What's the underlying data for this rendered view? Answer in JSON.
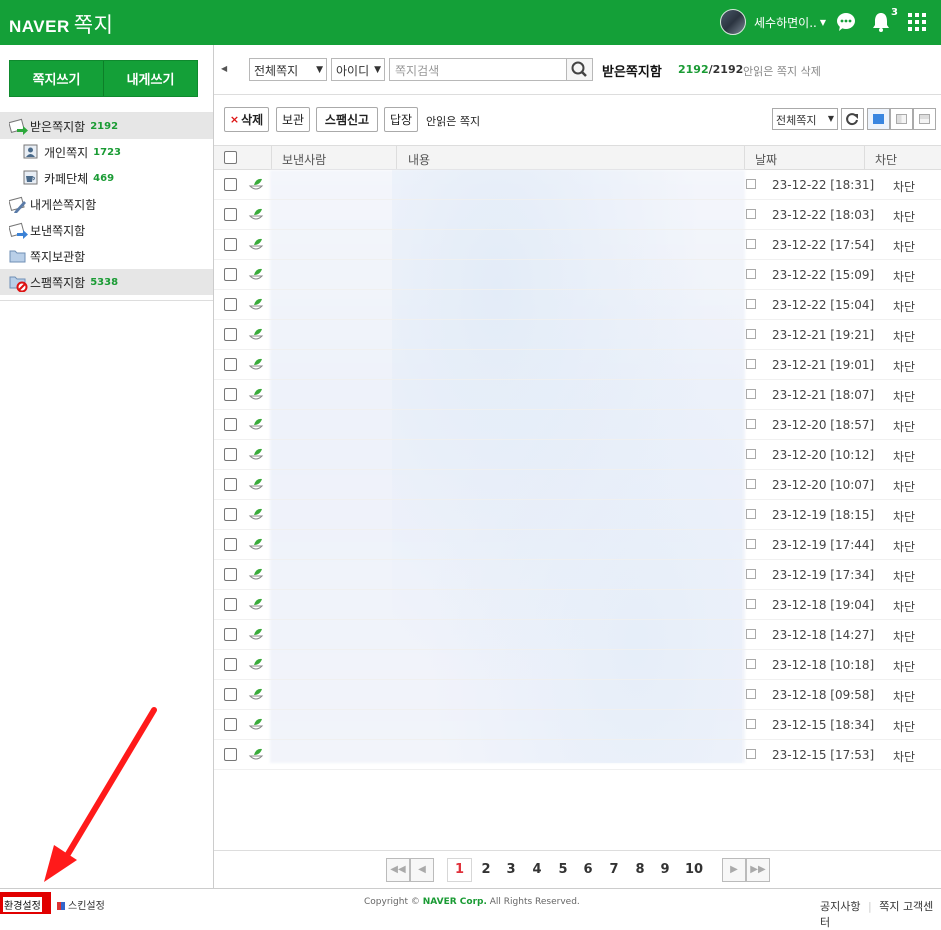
{
  "app": {
    "logo": "NAVER",
    "service": "쪽지"
  },
  "user": {
    "name": "세수하면이..",
    "notif_count": "3"
  },
  "sidebar": {
    "write_btn": "쪽지쓰기",
    "self_btn": "내게쓰기",
    "folders": [
      {
        "label": "받은쪽지함",
        "count": "2192"
      },
      {
        "label": "개인쪽지",
        "count": "1723"
      },
      {
        "label": "카페단체",
        "count": "469"
      },
      {
        "label": "내게쓴쪽지함",
        "count": ""
      },
      {
        "label": "보낸쪽지함",
        "count": ""
      },
      {
        "label": "쪽지보관함",
        "count": ""
      },
      {
        "label": "스팸쪽지함",
        "count": "5338"
      }
    ]
  },
  "search": {
    "filter": "전체쪽지",
    "field": "아이디",
    "placeholder": "쪽지검색"
  },
  "inbox": {
    "title": "받은쪽지함",
    "unread": "2192",
    "sep": "/",
    "total": "2192",
    "delete_unread": "안읽은 쪽지 삭제"
  },
  "toolbar": {
    "delete": "삭제",
    "keep": "보관",
    "spam": "스팸신고",
    "reply": "답장",
    "unread": "안읽은 쪽지",
    "filter": "전체쪽지"
  },
  "table": {
    "headers": {
      "sender": "보낸사람",
      "content": "내용",
      "date": "날짜",
      "block": "차단"
    },
    "rows": [
      {
        "date": "23-12-22 [18:31]",
        "block": "차단"
      },
      {
        "date": "23-12-22 [18:03]",
        "block": "차단"
      },
      {
        "date": "23-12-22 [17:54]",
        "block": "차단"
      },
      {
        "date": "23-12-22 [15:09]",
        "block": "차단"
      },
      {
        "date": "23-12-22 [15:04]",
        "block": "차단"
      },
      {
        "date": "23-12-21 [19:21]",
        "block": "차단"
      },
      {
        "date": "23-12-21 [19:01]",
        "block": "차단"
      },
      {
        "date": "23-12-21 [18:07]",
        "block": "차단"
      },
      {
        "date": "23-12-20 [18:57]",
        "block": "차단"
      },
      {
        "date": "23-12-20 [10:12]",
        "block": "차단"
      },
      {
        "date": "23-12-20 [10:07]",
        "block": "차단"
      },
      {
        "date": "23-12-19 [18:15]",
        "block": "차단"
      },
      {
        "date": "23-12-19 [17:44]",
        "block": "차단"
      },
      {
        "date": "23-12-19 [17:34]",
        "block": "차단"
      },
      {
        "date": "23-12-18 [19:04]",
        "block": "차단"
      },
      {
        "date": "23-12-18 [14:27]",
        "block": "차단"
      },
      {
        "date": "23-12-18 [10:18]",
        "block": "차단"
      },
      {
        "date": "23-12-18 [09:58]",
        "block": "차단"
      },
      {
        "date": "23-12-15 [18:34]",
        "block": "차단"
      },
      {
        "date": "23-12-15 [17:53]",
        "block": "차단"
      }
    ]
  },
  "pager": {
    "pages": [
      "1",
      "2",
      "3",
      "4",
      "5",
      "6",
      "7",
      "8",
      "9",
      "10"
    ],
    "current": "1"
  },
  "footer": {
    "settings": "환경설정",
    "skin": "스킨설정",
    "copyright_pre": "Copyright ©",
    "copyright_corp": "NAVER Corp.",
    "copyright_post": "All Rights Reserved.",
    "notice": "공지사항",
    "support": "쪽지 고객센터"
  },
  "colors": {
    "brand": "#14a038",
    "highlight": "#e10000",
    "arrow": "#ff1a1a"
  }
}
